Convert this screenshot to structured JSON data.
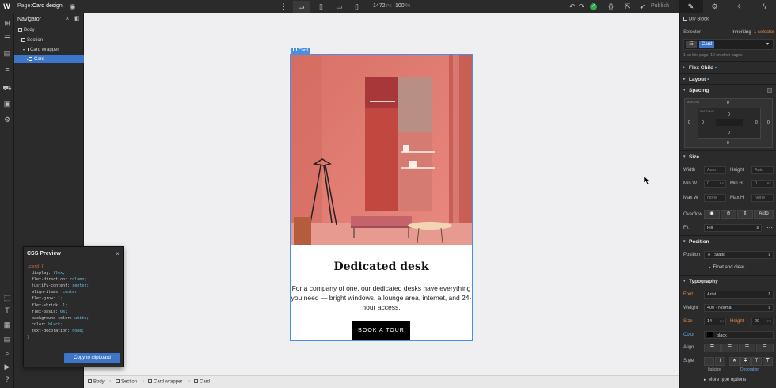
{
  "topbar": {
    "page_label": "Page:",
    "page_name": "Card design",
    "canvas_width": "1472",
    "canvas_width_unit": "PX",
    "zoom": "100",
    "zoom_unit": "%",
    "publish_label": "Publish"
  },
  "navigator": {
    "title": "Navigator",
    "items": [
      {
        "label": "Body"
      },
      {
        "label": "Section"
      },
      {
        "label": "Card wrapper"
      },
      {
        "label": "Card"
      }
    ]
  },
  "card": {
    "tag": "Card",
    "title": "Dedicated desk",
    "description": "For a company of one, our dedicated desks have everything you need — bright windows, a lounge area, internet, and 24-hour access.",
    "button": "BOOK A TOUR"
  },
  "css_preview": {
    "title": "CSS Preview",
    "selector": ".card {",
    "lines": [
      {
        "prop": "display:",
        "val": "flex;"
      },
      {
        "prop": "flex-direction:",
        "val": "column;"
      },
      {
        "prop": "justify-content:",
        "val": "center;"
      },
      {
        "prop": "align-items:",
        "val": "center;"
      },
      {
        "prop": "flex-grow:",
        "val": "1;"
      },
      {
        "prop": "flex-shrink:",
        "val": "1;"
      },
      {
        "prop": "flex-basis:",
        "val": "0%;"
      },
      {
        "prop": "background-color:",
        "val": "white;"
      },
      {
        "prop": "color:",
        "val": "black;"
      },
      {
        "prop": "text-decoration:",
        "val": "none;"
      }
    ],
    "closing": "}",
    "copy_button": "Copy to clipboard"
  },
  "breadcrumb": [
    "Body",
    "Section",
    "Card wrapper",
    "Card"
  ],
  "right_panel": {
    "element": "Div Block",
    "selector_label": "Selector",
    "inheriting": "Inheriting",
    "inheriting_count": "1 selector",
    "class_name": "Card",
    "usage": "1 on this page, 10 on other pages",
    "sections": {
      "flex_child": "Flex Child",
      "layout": "Layout",
      "spacing": "Spacing",
      "size": "Size",
      "position": "Position",
      "typography": "Typography"
    },
    "spacing": {
      "margin_label": "MARGIN",
      "padding_label": "PADDING",
      "values": [
        "0",
        "0",
        "0",
        "0",
        "0",
        "0",
        "0",
        "0"
      ]
    },
    "size": {
      "width_label": "Width",
      "width_val": "Auto",
      "height_label": "Height",
      "height_val": "Auto",
      "minw_label": "Min W",
      "minw_val": "0",
      "minw_unit": "PX",
      "minh_label": "Min H",
      "minh_val": "0",
      "minh_unit": "PX",
      "maxw_label": "Max W",
      "maxw_val": "None",
      "maxh_label": "Max H",
      "maxh_val": "None",
      "overflow_label": "Overflow",
      "overflow_auto": "Auto",
      "fit_label": "Fit",
      "fit_val": "Fill"
    },
    "position": {
      "label": "Position",
      "value": "Static",
      "float_clear": "Float and clear"
    },
    "typography": {
      "font_label": "Font",
      "font_val": "Arial",
      "weight_label": "Weight",
      "weight_val": "400 - Normal",
      "size_label": "Size",
      "size_val": "14",
      "size_unit": "PX",
      "height_label": "Height",
      "height_val": "20",
      "height_unit": "PX",
      "color_label": "Color",
      "color_val": "black",
      "align_label": "Align",
      "style_label": "Style",
      "italicize": "Italicize",
      "decoration": "Decoration",
      "more": "More type options"
    }
  },
  "colors": {
    "accent": "#3d76c8",
    "selection": "#4a90e2",
    "panel": "#2b2b2b",
    "canvas": "#efeff1"
  }
}
